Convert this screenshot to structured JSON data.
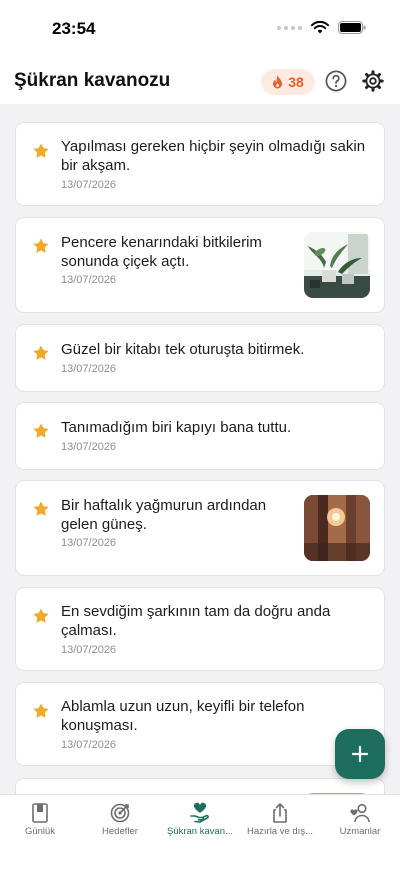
{
  "status_bar": {
    "time": "23:54"
  },
  "header": {
    "title": "Şükran kavanozu",
    "streak": {
      "icon": "flame-icon",
      "count": "38"
    },
    "help_icon": "question-circle-icon",
    "settings_icon": "gear-icon"
  },
  "entries": [
    {
      "text": "Yapılması gereken hiçbir şeyin olmadığı sakin bir akşam.",
      "date": "13/07/2026",
      "photo": false
    },
    {
      "text": "Pencere kenarındaki bitkilerim sonunda çiçek açtı.",
      "date": "13/07/2026",
      "photo": true
    },
    {
      "text": "Güzel bir kitabı tek oturuşta bitirmek.",
      "date": "13/07/2026",
      "photo": false
    },
    {
      "text": "Tanımadığım biri kapıyı bana tuttu.",
      "date": "13/07/2026",
      "photo": false
    },
    {
      "text": "Bir haftalık yağmurun ardından gelen güneş.",
      "date": "13/07/2026",
      "photo": true
    },
    {
      "text": "En sevdiğim şarkının tam da doğru anda çalması.",
      "date": "13/07/2026",
      "photo": false
    },
    {
      "text": "Ablamla uzun uzun, keyifli bir telefon konuşması.",
      "date": "13/07/2026",
      "photo": false
    }
  ],
  "fab": {
    "icon": "plus-icon"
  },
  "tabs": [
    {
      "label": "Günlük",
      "icon": "journal-icon",
      "active": false
    },
    {
      "label": "Hedefler",
      "icon": "target-icon",
      "active": false
    },
    {
      "label": "Şükran kavan...",
      "icon": "heart-hand-icon",
      "active": true
    },
    {
      "label": "Hazırla ve dış...",
      "icon": "share-icon",
      "active": false
    },
    {
      "label": "Uzmanlar",
      "icon": "person-heart-icon",
      "active": false
    }
  ],
  "colors": {
    "accent": "#1e6e60",
    "star": "#f0a929",
    "streak": "#e2622d"
  }
}
